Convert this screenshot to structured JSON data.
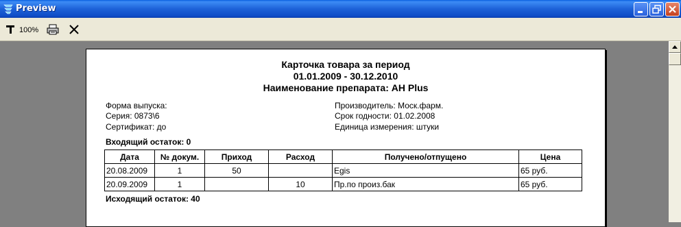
{
  "window": {
    "title": "Preview",
    "app_icon": "fr-logo-icon",
    "buttons": [
      "minimize-icon",
      "restore-icon",
      "close-icon"
    ]
  },
  "toolbar": {
    "zoom_icon": "zoom-pin-icon",
    "zoom_label": "100%",
    "print_icon": "printer-icon",
    "close_icon": "close-x-icon"
  },
  "report": {
    "title": "Карточка товара за период",
    "period": "01.01.2009 - 30.12.2010",
    "drug": "Наименование препарата: AH Plus",
    "left_info": {
      "form": "Форма выпуска:",
      "series": "Серия: 0873\\6",
      "certificate": "Сертификат:  до"
    },
    "right_info": {
      "manufacturer": "Производитель: Моск.фарм.",
      "expiry": "Срок годности: 01.02.2008",
      "unit": "Единица измерения: штуки"
    },
    "opening_balance": "Входящий остаток: 0",
    "closing_balance": "Исходящий остаток: 40",
    "table": {
      "headers": [
        "Дата",
        "№ докум.",
        "Приход",
        "Расход",
        "Получено/отпущено",
        "Цена"
      ],
      "rows": [
        [
          "20.08.2009",
          "1",
          "50",
          "",
          "Egis",
          "65 руб."
        ],
        [
          "20.09.2009",
          "1",
          "",
          "10",
          "Пр.по произ.бак",
          "65 руб."
        ]
      ]
    }
  },
  "colors": {
    "titlebar": "#0a5fe0",
    "toolbar": "#ece9d8",
    "workspace": "#808080",
    "paper": "#ffffff"
  }
}
